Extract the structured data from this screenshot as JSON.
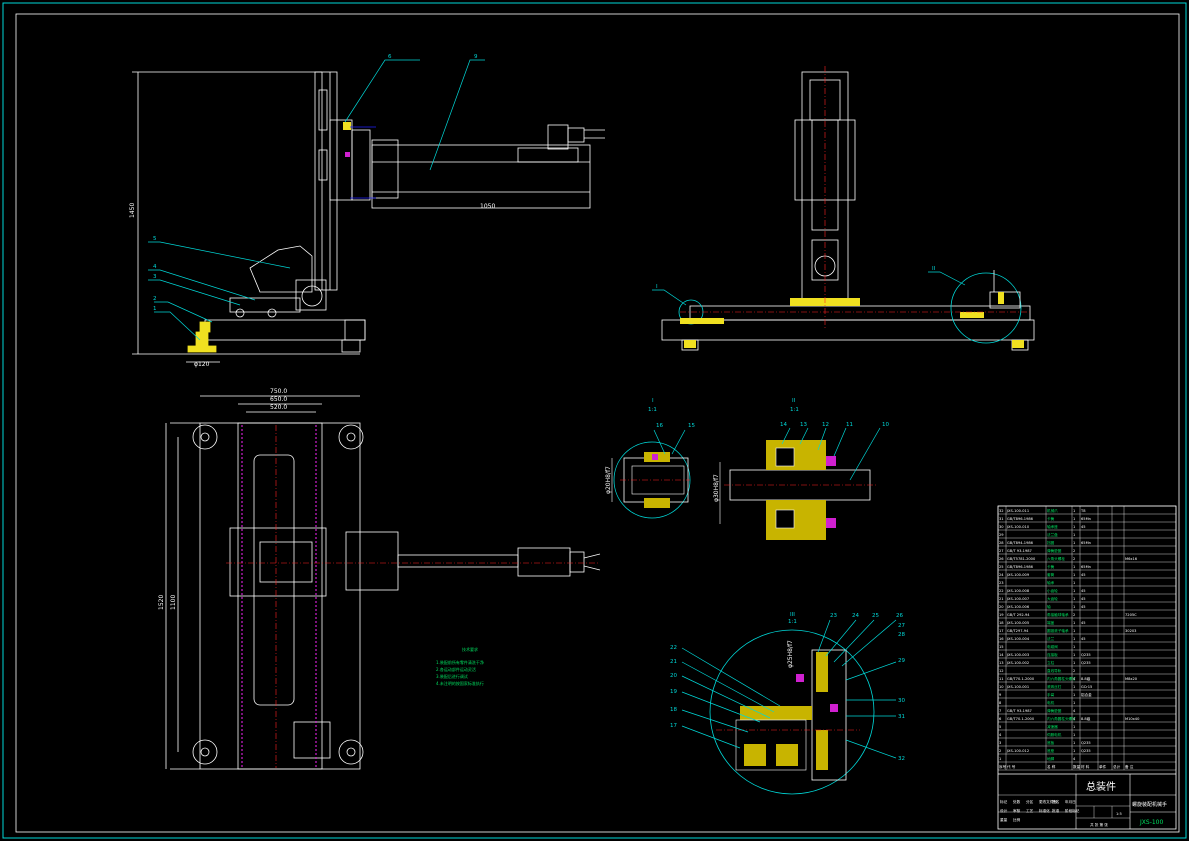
{
  "drawing": {
    "callouts_front": [
      "6",
      "7",
      "8",
      "9",
      "5",
      "4",
      "3",
      "2",
      "1"
    ],
    "callouts_side": [
      "I",
      "II"
    ],
    "dimensions": {
      "height": "1450",
      "arm_length": "1050",
      "foot": "φ120",
      "top_w1": "750.0",
      "top_w2": "650.0",
      "top_w3": "520.0",
      "left_h1": "1520",
      "left_h2": "1100",
      "detail_i_dia": "φ20H8/f7",
      "detail_ii_dia": "φ30H8/f7",
      "detail_iii_dia": "φ25H8/f7"
    },
    "detail_i": {
      "title": "I",
      "scale": "1:1",
      "callouts": [
        "16",
        "15"
      ]
    },
    "detail_ii": {
      "title": "II",
      "scale": "1:1",
      "callouts": [
        "14",
        "13",
        "12",
        "11",
        "10"
      ]
    },
    "detail_iii": {
      "title": "III",
      "scale": "1:1",
      "callouts": [
        "23",
        "24",
        "25",
        "26",
        "27",
        "28",
        "22",
        "21",
        "20",
        "19",
        "18",
        "17",
        "29",
        "30",
        "31",
        "32"
      ]
    },
    "tech_req": {
      "title": "技术要求",
      "lines": [
        "1.装配前所有零件清洗干净",
        "2.各运动部件运动灵活",
        "3.装配后进行调试",
        "4.未注明的按国家标准执行"
      ]
    }
  },
  "title_block": {
    "name": "总装件",
    "product": "螺旋装配机械手",
    "code": "JXS-100",
    "scale": "1:5",
    "sheet_label": "共 张 第 张",
    "header": [
      "序号",
      "代 号",
      "名 称",
      "数量",
      "材 料",
      "单件",
      "总计",
      "备 注"
    ],
    "rows": [
      [
        "32",
        "JXS-100-011",
        "机械爪",
        "1",
        "T8",
        ""
      ],
      [
        "31",
        "GB/T896-1986",
        "卡簧",
        "1",
        "65Mn",
        ""
      ],
      [
        "30",
        "JXS-100-010",
        "轴承座",
        "1",
        "45",
        ""
      ],
      [
        "29",
        "",
        "法兰盘",
        "1",
        "",
        ""
      ],
      [
        "28",
        "GB/T894-1986",
        "挡圈",
        "1",
        "65Mn",
        ""
      ],
      [
        "27",
        "GB/T 93-1987",
        "弹簧垫圈",
        "2",
        "",
        ""
      ],
      [
        "26",
        "GB/T5781-2000",
        "六角头螺栓",
        "2",
        "",
        "M6x16"
      ],
      [
        "25",
        "GB/T896-1986",
        "卡簧",
        "1",
        "65Mn",
        ""
      ],
      [
        "24",
        "JXS-100-009",
        "套筒",
        "1",
        "45",
        ""
      ],
      [
        "23",
        "",
        "轴承",
        "1",
        "",
        ""
      ],
      [
        "22",
        "JXS-100-008",
        "小齿轮",
        "1",
        "45",
        ""
      ],
      [
        "21",
        "JXS-100-007",
        "大齿轮",
        "1",
        "45",
        ""
      ],
      [
        "20",
        "JXS-100-006",
        "轴",
        "1",
        "45",
        ""
      ],
      [
        "19",
        "GB/T 292-94",
        "角接触球轴承",
        "2",
        "",
        "7205C"
      ],
      [
        "18",
        "JXS-100-005",
        "端盖",
        "1",
        "45",
        ""
      ],
      [
        "17",
        "GB/T297-94",
        "圆锥滚子轴承",
        "1",
        "",
        "30203"
      ],
      [
        "16",
        "JXS-100-004",
        "法兰",
        "1",
        "45",
        ""
      ],
      [
        "15",
        "",
        "电磁阀",
        "1",
        "",
        ""
      ],
      [
        "14",
        "JXS-100-003",
        "连接板",
        "1",
        "Q235",
        ""
      ],
      [
        "13",
        "JXS-100-002",
        "立柱",
        "1",
        "Q235",
        ""
      ],
      [
        "12",
        "",
        "直线导轨",
        "2",
        "",
        ""
      ],
      [
        "11",
        "GB/T70.1-2000",
        "内六角圆柱头螺钉",
        "4",
        "8.8级",
        "M8x20"
      ],
      [
        "10",
        "JXS-100-001",
        "滚珠丝杠",
        "1",
        "GCr15",
        ""
      ],
      [
        "9",
        "",
        "手臂",
        "1",
        "铝合金",
        ""
      ],
      [
        "8",
        "",
        "电机",
        "1",
        "",
        ""
      ],
      [
        "7",
        "GB/T 93-1987",
        "弹簧垫圈",
        "4",
        "",
        ""
      ],
      [
        "6",
        "GB/T70.1-2000",
        "内六角圆柱头螺钉",
        "4",
        "8.8级",
        "M10x40"
      ],
      [
        "5",
        "",
        "减速器",
        "1",
        "",
        ""
      ],
      [
        "4",
        "",
        "伺服电机",
        "1",
        "",
        ""
      ],
      [
        "3",
        "",
        "底板",
        "1",
        "Q235",
        ""
      ],
      [
        "2",
        "JXS-100-012",
        "底座",
        "1",
        "Q235",
        ""
      ],
      [
        "1",
        "",
        "地脚",
        "4",
        "",
        ""
      ]
    ],
    "sign_labels": [
      "标记",
      "处数",
      "分区",
      "更改文件号",
      "签名",
      "年月日",
      "设计",
      "审核",
      "工艺",
      "标准化",
      "批准",
      "阶段标记",
      "重量",
      "比例"
    ]
  },
  "colors": {
    "background": "#000000",
    "outline": "#ffffff",
    "leader": "#00d8d8",
    "highlight": "#f0e020",
    "center": "#ff2020",
    "hatch": "#c8b400",
    "accent": "#d020d0",
    "note": "#00e060"
  }
}
